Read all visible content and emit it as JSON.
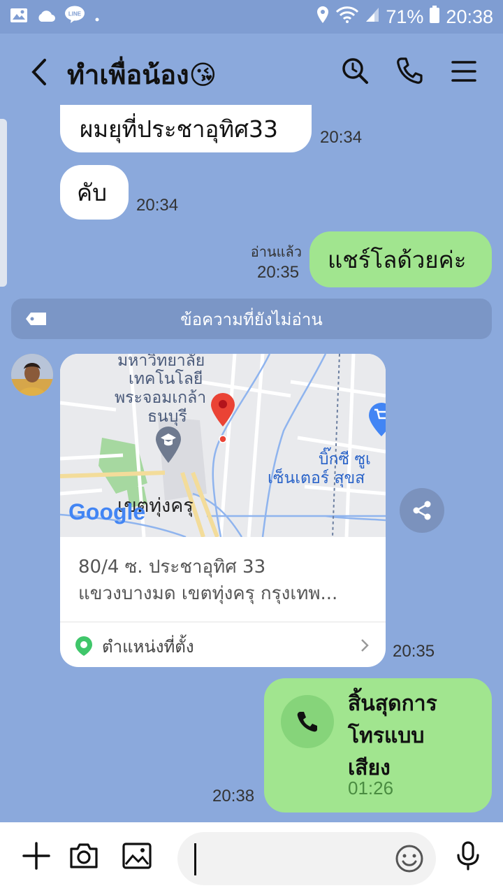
{
  "status_bar": {
    "battery": "71%",
    "time": "20:38",
    "line_badge": "LINE"
  },
  "header": {
    "title": "ทำเพื่อน้อง😘"
  },
  "messages": [
    {
      "side": "in",
      "text": "ผมยุที่ประชาอุทิศ33",
      "time": "20:34"
    },
    {
      "side": "in",
      "text": "คับ",
      "time": "20:34"
    },
    {
      "side": "out",
      "text": "แชร์โลด้วยค่ะ",
      "time": "20:35",
      "read": "อ่านแล้ว"
    }
  ],
  "unread_divider": "ข้อความที่ยังไม่อ่าน",
  "location": {
    "map_labels": {
      "university": "มหาวิทยาลัย",
      "tech": "เทคโนโลยี",
      "kmutt": "พระจอมเกล้า",
      "thonburi": "ธนบุรี",
      "bigc_1": "บิ๊กซี ซูเ",
      "bigc_2": "เซ็นเตอร์ สุขส",
      "district": "เขตทุ่งครุ",
      "google": "Google"
    },
    "address_line1": "80/4 ซ. ประชาอุทิศ 33",
    "address_line2": "แขวงบางมด เขตทุ่งครุ กรุงเทพ...",
    "link_label": "ตำแหน่งที่ตั้ง",
    "time": "20:35"
  },
  "call": {
    "text_line1": "สิ้นสุดการ",
    "text_line2": "โทรแบบ",
    "text_line3": "เสียง",
    "duration": "01:26",
    "time": "20:38"
  },
  "colors": {
    "background": "#8ba9dc",
    "bubble_out": "#a1e58f",
    "bubble_in": "#ffffff"
  }
}
